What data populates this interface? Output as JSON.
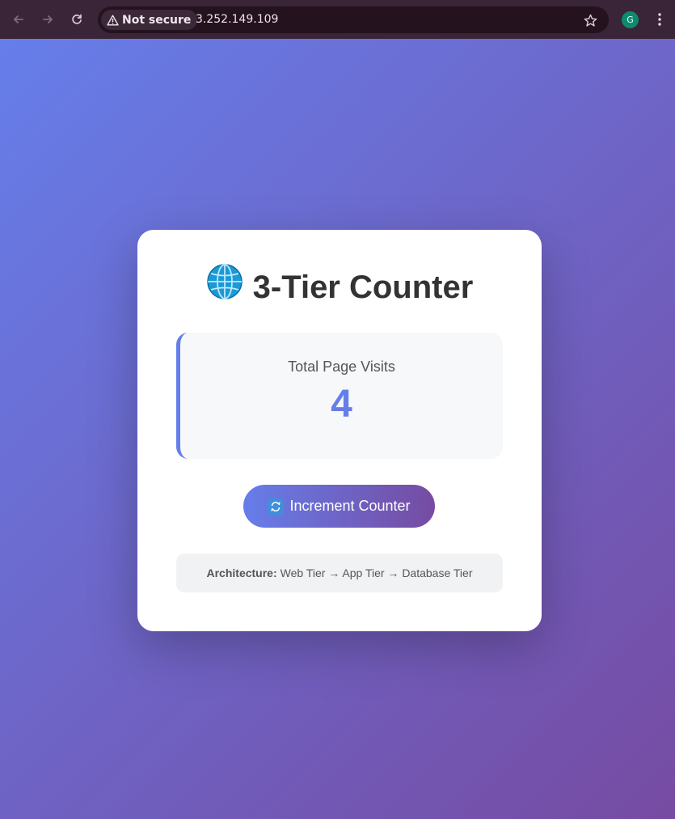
{
  "browser": {
    "security_label": "Not secure",
    "url": "3.252.149.109",
    "profile_initial": "G"
  },
  "card": {
    "title": "3-Tier Counter",
    "title_icon": "globe-icon",
    "visits_label": "Total Page Visits",
    "visits_count": "4",
    "button_label": "Increment Counter",
    "button_icon": "refresh-icon",
    "architecture_label": "Architecture:",
    "architecture_text": "Web Tier → App Tier → Database Tier"
  },
  "colors": {
    "accent": "#667eea",
    "gradient_end": "#764ba2",
    "title": "#333333"
  }
}
